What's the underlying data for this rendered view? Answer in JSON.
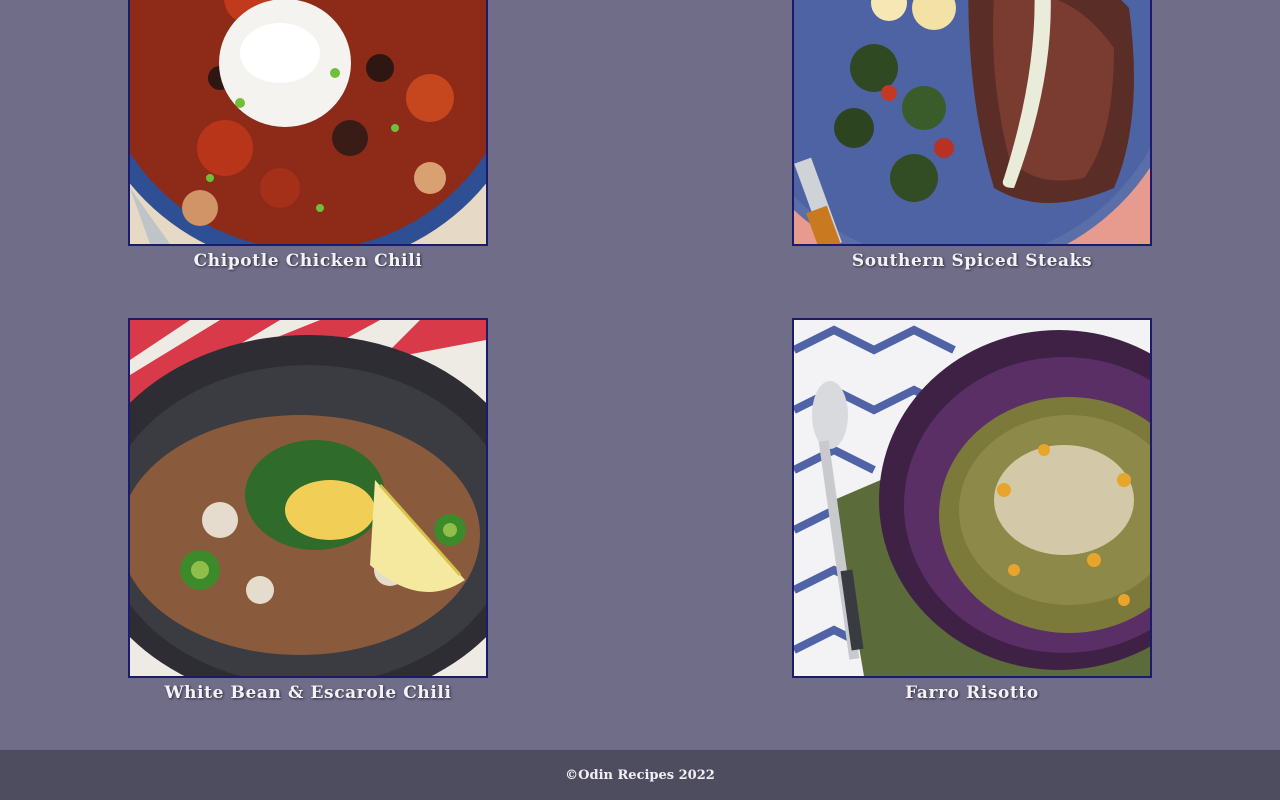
{
  "recipes": [
    {
      "title": "Chipotle Chicken Chili",
      "image": "chipotle-chicken-chili-photo"
    },
    {
      "title": "Southern Spiced Steaks",
      "image": "southern-spiced-steaks-photo"
    },
    {
      "title": "White Bean & Escarole Chili",
      "image": "white-bean-escarole-chili-photo"
    },
    {
      "title": "Farro Risotto",
      "image": "farro-risotto-photo"
    }
  ],
  "footer": {
    "text": "©Odin Recipes 2022"
  },
  "colors": {
    "page_background": "#6f6d87",
    "footer_background": "#4e4c5f",
    "image_border": "#1b1a6b",
    "caption_text": "#f4f2f8"
  }
}
